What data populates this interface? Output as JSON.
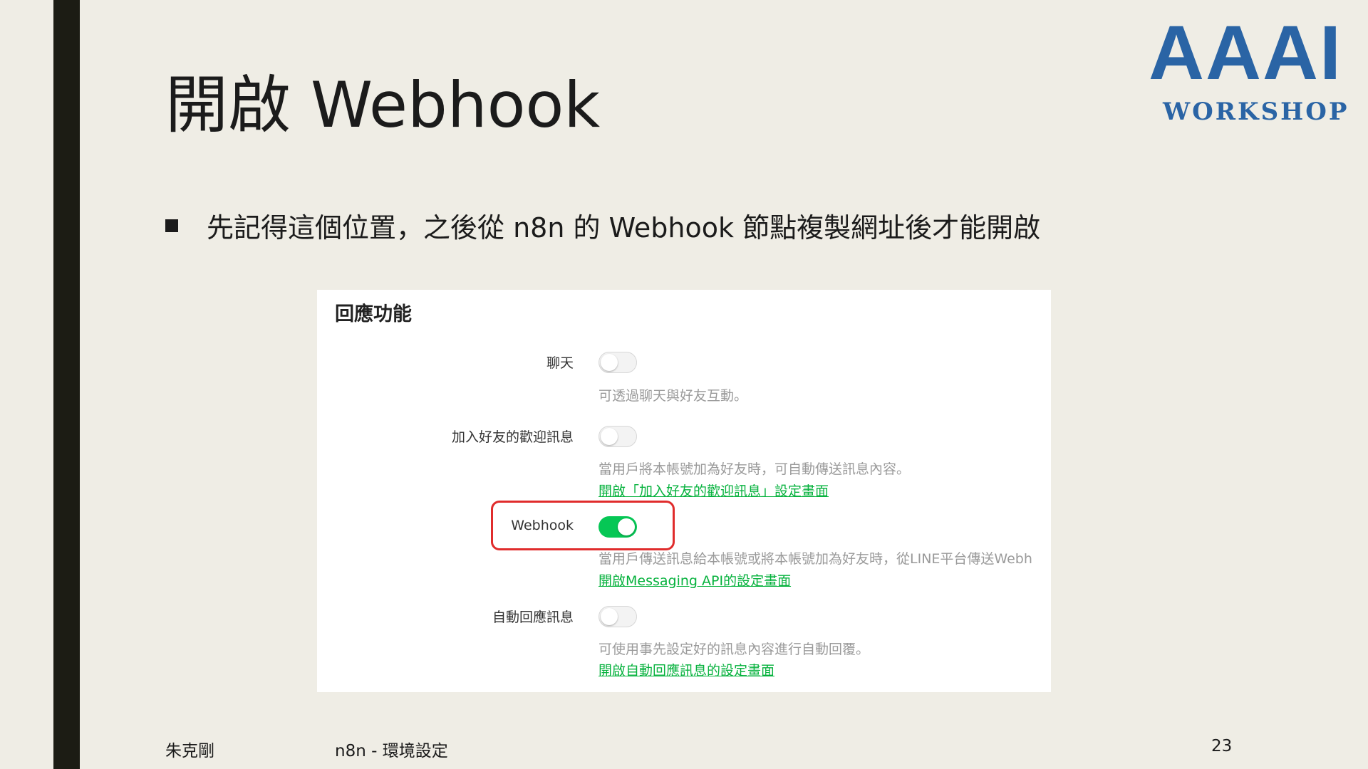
{
  "slide": {
    "title": "開啟 Webhook",
    "bullet": "先記得這個位置，之後從 n8n 的 Webhook 節點複製網址後才能開啟",
    "footer": {
      "author": "朱克剛",
      "topic": "n8n - 環境設定",
      "page": "23"
    },
    "logo": {
      "main": "AAAI",
      "sub": "WORKSHOP"
    }
  },
  "panel": {
    "title": "回應功能",
    "rows": [
      {
        "label": "聊天",
        "enabled": false,
        "description": "可透過聊天與好友互動。",
        "link": ""
      },
      {
        "label": "加入好友的歡迎訊息",
        "enabled": false,
        "description": "當用戶將本帳號加為好友時，可自動傳送訊息內容。",
        "link": "開啟「加入好友的歡迎訊息」設定畫面"
      },
      {
        "label": "Webhook",
        "enabled": true,
        "description": "當用戶傳送訊息給本帳號或將本帳號加為好友時，從LINE平台傳送Webh",
        "link": "開啟Messaging API的設定畫面"
      },
      {
        "label": "自動回應訊息",
        "enabled": false,
        "description": "可使用事先設定好的訊息內容進行自動回覆。",
        "link": "開啟自動回應訊息的設定畫面"
      }
    ]
  },
  "colors": {
    "background": "#efede5",
    "accent_bar": "#1c1c14",
    "logo_blue": "#2a64a5",
    "toggle_on": "#06c755",
    "link_green": "#06b23d",
    "highlight_red": "#e02c2c"
  }
}
